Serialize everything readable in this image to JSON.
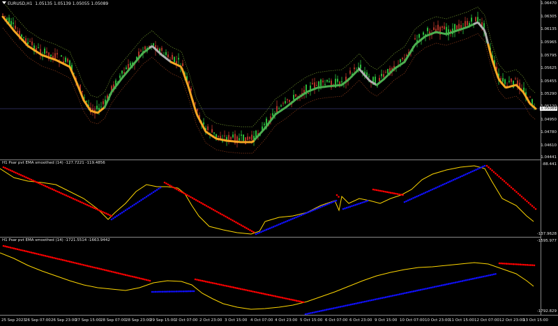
{
  "main": {
    "symbol": "EURUSD,H1",
    "ohlc": "1.05135 1.05139 1.05055 1.05089",
    "current_price": "1.05089",
    "price_ticks": [
      "1.06470",
      "1.06305",
      "1.06135",
      "1.05965",
      "1.05795",
      "1.05625",
      "1.05455",
      "1.05290",
      "1.05120",
      "1.04950",
      "1.04780",
      "1.04610",
      "1.04441"
    ]
  },
  "indicator1": {
    "label": "Psar pvt EMA smoothed (14) -127.7221 -119.4856",
    "timeframe": "H1",
    "max_tick": "-88.441",
    "min_tick": "-137.9628"
  },
  "indicator2": {
    "label": "Psar pvt EMA smoothed (14) -1721.5514 -1663.9442",
    "timeframe": "H1",
    "max_tick": "-1595.977",
    "min_tick": "-1792.829"
  },
  "time_axis": {
    "labels": [
      "25 Sep 2023",
      "26 Sep 07:00",
      "26 Sep 23:00",
      "27 Sep 15:00",
      "28 Sep 07:00",
      "28 Sep 23:00",
      "29 Sep 15:00",
      "2 Oct 07:00",
      "2 Oct 23:00",
      "3 Oct 15:00",
      "4 Oct 07:00",
      "4 Oct 23:00",
      "5 Oct 15:00",
      "6 Oct 07:00",
      "6 Oct 23:00",
      "9 Oct 15:00",
      "10 Oct 07:00",
      "10 Oct 23:00",
      "11 Oct 15:00",
      "12 Oct 07:00",
      "12 Oct 23:00",
      "13 Oct 15:00"
    ]
  },
  "colors": {
    "background": "#000000",
    "bull_candle": "#2ecc40",
    "bear_candle": "#c0392b",
    "ma_orange": "#f5a623",
    "ma_green": "#4caf50",
    "ma_gray": "#b0b0b0",
    "indicator_line": "#ffd700",
    "psar_red": "#ff0000",
    "psar_blue": "#1010ff"
  },
  "chart_data": {
    "type": "candlestick",
    "main_series": {
      "name": "EURUSD,H1",
      "ylim": [
        1.04441,
        1.0647
      ],
      "approx_close": [
        1.063,
        1.0625,
        1.0605,
        1.06,
        1.0592,
        1.058,
        1.057,
        1.0565,
        1.054,
        1.052,
        1.051,
        1.0508,
        1.053,
        1.056,
        1.059,
        1.06,
        1.061,
        1.0595,
        1.0575,
        1.055,
        1.052,
        1.0495,
        1.048,
        1.047,
        1.0468,
        1.0475,
        1.049,
        1.051,
        1.052,
        1.053,
        1.054,
        1.0545,
        1.055,
        1.0548,
        1.056,
        1.057,
        1.058,
        1.0575,
        1.056,
        1.0555,
        1.0565,
        1.059,
        1.0605,
        1.061,
        1.0615,
        1.0625,
        1.0635,
        1.06,
        1.056,
        1.054,
        1.0535,
        1.052,
        1.051
      ]
    },
    "indicator1": {
      "name": "Psar pvt EMA smoothed (14)",
      "ylim": [
        -137.9628,
        -88.441
      ],
      "values": [
        -127.7221,
        -119.4856
      ]
    },
    "indicator2": {
      "name": "Psar pvt EMA smoothed (14)",
      "ylim": [
        -1792.829,
        -1595.977
      ],
      "values": [
        -1721.5514,
        -1663.9442
      ]
    }
  }
}
